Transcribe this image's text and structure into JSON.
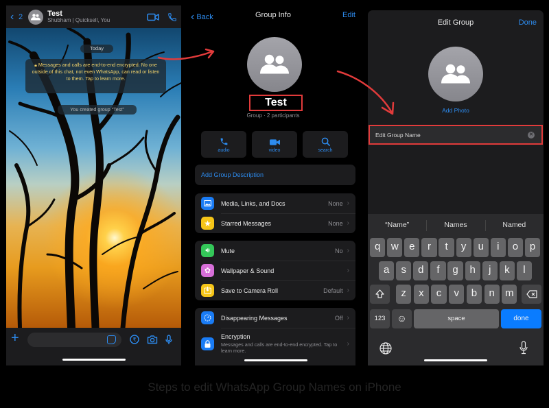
{
  "chat": {
    "back_count": "2",
    "title": "Test",
    "subtitle": "Shubham | Quicksell, You",
    "date_chip": "Today",
    "e2e_notice": "Messages and calls are end-to-end encrypted. No one outside of this chat, not even WhatsApp, can read or listen to them. Tap to learn more.",
    "system_message": "You created group “Test”",
    "message_input_placeholder": "",
    "colors": {
      "accent": "#2d8cf0",
      "notice_text": "#f2d36b"
    }
  },
  "group_info": {
    "back_label": "Back",
    "title": "Group Info",
    "edit_label": "Edit",
    "group_name": "Test",
    "group_subtitle": "Group · 2 participants",
    "actions": [
      {
        "label": "audio",
        "icon": "phone-icon"
      },
      {
        "label": "video",
        "icon": "video-icon"
      },
      {
        "label": "search",
        "icon": "search-icon"
      }
    ],
    "add_description": "Add Group Description",
    "section1": [
      {
        "label": "Media, Links, and Docs",
        "value": "None",
        "icon": "photo-icon",
        "color": "#1a7cf5"
      },
      {
        "label": "Starred Messages",
        "value": "None",
        "icon": "star-icon",
        "color": "#f5c518"
      }
    ],
    "section2": [
      {
        "label": "Mute",
        "value": "No",
        "icon": "speaker-icon",
        "color": "#34c759"
      },
      {
        "label": "Wallpaper & Sound",
        "value": "",
        "icon": "flower-icon",
        "color": "#d76fd8"
      },
      {
        "label": "Save to Camera Roll",
        "value": "Default",
        "icon": "download-icon",
        "color": "#f5c518"
      }
    ],
    "section3": [
      {
        "label": "Disappearing Messages",
        "value": "Off",
        "icon": "timer-icon",
        "color": "#1a7cf5"
      },
      {
        "label": "Encryption",
        "sub": "Messages and calls are end-to-end encrypted. Tap to learn more.",
        "icon": "lock-icon",
        "color": "#1a7cf5"
      }
    ]
  },
  "edit_group": {
    "title": "Edit Group",
    "done_label": "Done",
    "add_photo": "Add Photo",
    "name_placeholder": "Edit Group Name",
    "suggestions": [
      "“Name”",
      "Names",
      "Named"
    ],
    "keys_row1": [
      "q",
      "w",
      "e",
      "r",
      "t",
      "y",
      "u",
      "i",
      "o",
      "p"
    ],
    "keys_row2": [
      "a",
      "s",
      "d",
      "f",
      "g",
      "h",
      "j",
      "k",
      "l"
    ],
    "keys_row3": [
      "z",
      "x",
      "c",
      "v",
      "b",
      "n",
      "m"
    ],
    "numbers_key": "123",
    "space_key": "space",
    "done_key": "done",
    "done_key_color": "#0a7cff"
  },
  "caption": "Steps to edit WhatsApp Group Names on iPhone",
  "annotation_color": "#e23b3b"
}
